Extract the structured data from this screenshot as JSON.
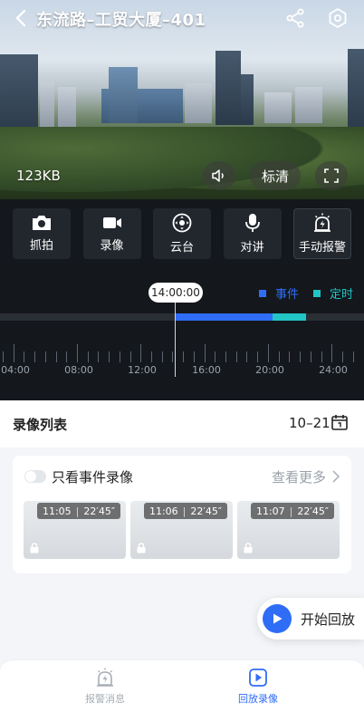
{
  "header": {
    "title": "东流路–工贸大厦–401"
  },
  "video": {
    "size_label": "123KB",
    "quality_label": "标清"
  },
  "actions": [
    {
      "label": "抓拍",
      "icon": "camera-icon"
    },
    {
      "label": "录像",
      "icon": "video-icon"
    },
    {
      "label": "云台",
      "icon": "ptz-icon"
    },
    {
      "label": "对讲",
      "icon": "microphone-icon"
    },
    {
      "label": "手动报警",
      "icon": "alarm-icon"
    }
  ],
  "timeline": {
    "current_time": "14:00:00",
    "legend": [
      {
        "label": "事件",
        "color": "#2f6df6"
      },
      {
        "label": "定时",
        "color": "#22c5c5"
      }
    ],
    "tick_labels": [
      "04:00",
      "08:00",
      "12:00",
      "16:00",
      "20:00",
      "24:00"
    ]
  },
  "recording_list": {
    "title": "录像列表",
    "date": "10–21",
    "only_event_label": "只看事件录像",
    "more_label": "查看更多",
    "only_event_enabled": false,
    "clips": [
      {
        "start": "11:05",
        "duration": "22′45″",
        "locked": true
      },
      {
        "start": "11:06",
        "duration": "22′45″",
        "locked": true
      },
      {
        "start": "11:07",
        "duration": "22′45″",
        "locked": true
      }
    ]
  },
  "play_button": {
    "label": "开始回放"
  },
  "bottom_nav": [
    {
      "label": "报警消息",
      "icon": "alarm-icon",
      "active": false
    },
    {
      "label": "回放录像",
      "icon": "play-icon",
      "active": true
    }
  ],
  "colors": {
    "accent": "#2f6df6",
    "timed": "#22c5c5",
    "dark_bg": "#14171c"
  }
}
